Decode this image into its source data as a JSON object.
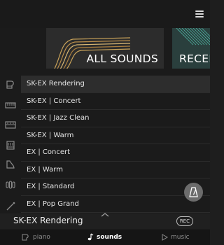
{
  "tiles": [
    {
      "label": "ALL SOUNDS",
      "icon": "all-sounds-wave-art"
    },
    {
      "label": "RECENT",
      "icon": "recent-stripes-art"
    }
  ],
  "filters": [
    {
      "name": "grand-piano-filter-icon"
    },
    {
      "name": "electric-piano-filter-icon"
    },
    {
      "name": "synth-filter-icon"
    },
    {
      "name": "organ-filter-icon"
    },
    {
      "name": "harpsichord-filter-icon"
    },
    {
      "name": "strings-filter-icon"
    },
    {
      "name": "more-filter-icon"
    }
  ],
  "sounds": [
    "SK-EX Rendering",
    "SK-EX | Concert",
    "SK-EX | Jazz Clean",
    "SK-EX | Warm",
    "EX | Concert",
    "EX | Warm",
    "EX | Standard",
    "EX | Pop Grand"
  ],
  "now_playing": {
    "title": "SK-EX Rendering",
    "rec_label": "REC"
  },
  "nav": {
    "piano": "piano",
    "sounds": "sounds",
    "music": "music"
  },
  "colors": {
    "background": "#1b1b1b",
    "tile_all": "#2c2c2c",
    "tile_recent": "#2a3f3d",
    "selected_row": "#2d2d2d",
    "accent_gold": "#c9a35a",
    "accent_teal": "#4fb3a3"
  }
}
